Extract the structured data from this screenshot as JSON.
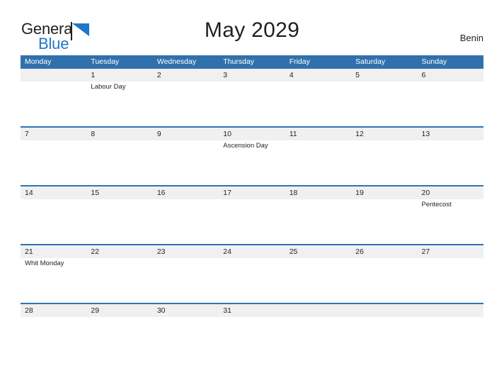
{
  "brand": {
    "name_part1": "General",
    "name_part2": "Blue",
    "flag_icon": "blue-triangle-flag-icon",
    "color_dark": "#231f20",
    "color_blue": "#2176c7"
  },
  "header": {
    "title": "May 2029",
    "country": "Benin"
  },
  "colors": {
    "header_blue": "#3071ad",
    "week_divider_blue": "#2e74b5",
    "date_band_gray": "#f0f0f0",
    "text": "#231f20",
    "header_text": "#ffffff"
  },
  "calendar": {
    "weekday_headers": [
      "Monday",
      "Tuesday",
      "Wednesday",
      "Thursday",
      "Friday",
      "Saturday",
      "Sunday"
    ],
    "weeks": [
      {
        "days": [
          {
            "date": "",
            "holiday": ""
          },
          {
            "date": "1",
            "holiday": "Labour Day"
          },
          {
            "date": "2",
            "holiday": ""
          },
          {
            "date": "3",
            "holiday": ""
          },
          {
            "date": "4",
            "holiday": ""
          },
          {
            "date": "5",
            "holiday": ""
          },
          {
            "date": "6",
            "holiday": ""
          }
        ]
      },
      {
        "days": [
          {
            "date": "7",
            "holiday": ""
          },
          {
            "date": "8",
            "holiday": ""
          },
          {
            "date": "9",
            "holiday": ""
          },
          {
            "date": "10",
            "holiday": "Ascension Day"
          },
          {
            "date": "11",
            "holiday": ""
          },
          {
            "date": "12",
            "holiday": ""
          },
          {
            "date": "13",
            "holiday": ""
          }
        ]
      },
      {
        "days": [
          {
            "date": "14",
            "holiday": ""
          },
          {
            "date": "15",
            "holiday": ""
          },
          {
            "date": "16",
            "holiday": ""
          },
          {
            "date": "17",
            "holiday": ""
          },
          {
            "date": "18",
            "holiday": ""
          },
          {
            "date": "19",
            "holiday": ""
          },
          {
            "date": "20",
            "holiday": "Pentecost"
          }
        ]
      },
      {
        "days": [
          {
            "date": "21",
            "holiday": "Whit Monday"
          },
          {
            "date": "22",
            "holiday": ""
          },
          {
            "date": "23",
            "holiday": ""
          },
          {
            "date": "24",
            "holiday": ""
          },
          {
            "date": "25",
            "holiday": ""
          },
          {
            "date": "26",
            "holiday": ""
          },
          {
            "date": "27",
            "holiday": ""
          }
        ]
      },
      {
        "days": [
          {
            "date": "28",
            "holiday": ""
          },
          {
            "date": "29",
            "holiday": ""
          },
          {
            "date": "30",
            "holiday": ""
          },
          {
            "date": "31",
            "holiday": ""
          },
          {
            "date": "",
            "holiday": ""
          },
          {
            "date": "",
            "holiday": ""
          },
          {
            "date": "",
            "holiday": ""
          }
        ]
      }
    ]
  }
}
